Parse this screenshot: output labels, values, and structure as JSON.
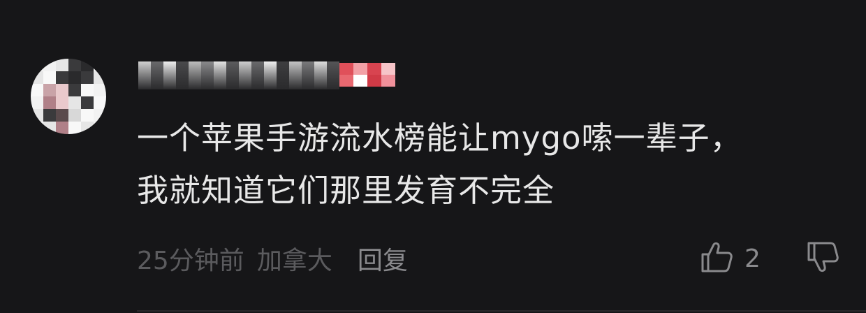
{
  "comment": {
    "avatar_icon": "user-avatar",
    "username_redacted": true,
    "badge_color": "#e0505a",
    "text_lines": [
      "一个苹果手游流水榜能让mygo嗦一辈子，",
      "我就知道它们那里发育不完全"
    ],
    "time": "25分钟前",
    "location": "加拿大",
    "reply_label": "回复",
    "like_icon": "thumbs-up-icon",
    "like_count": "2",
    "dislike_icon": "thumbs-down-icon"
  },
  "colors": {
    "background": "#161618",
    "text": "#e8e8e8",
    "meta": "#5b5b5e",
    "action": "#8a8a8d"
  }
}
